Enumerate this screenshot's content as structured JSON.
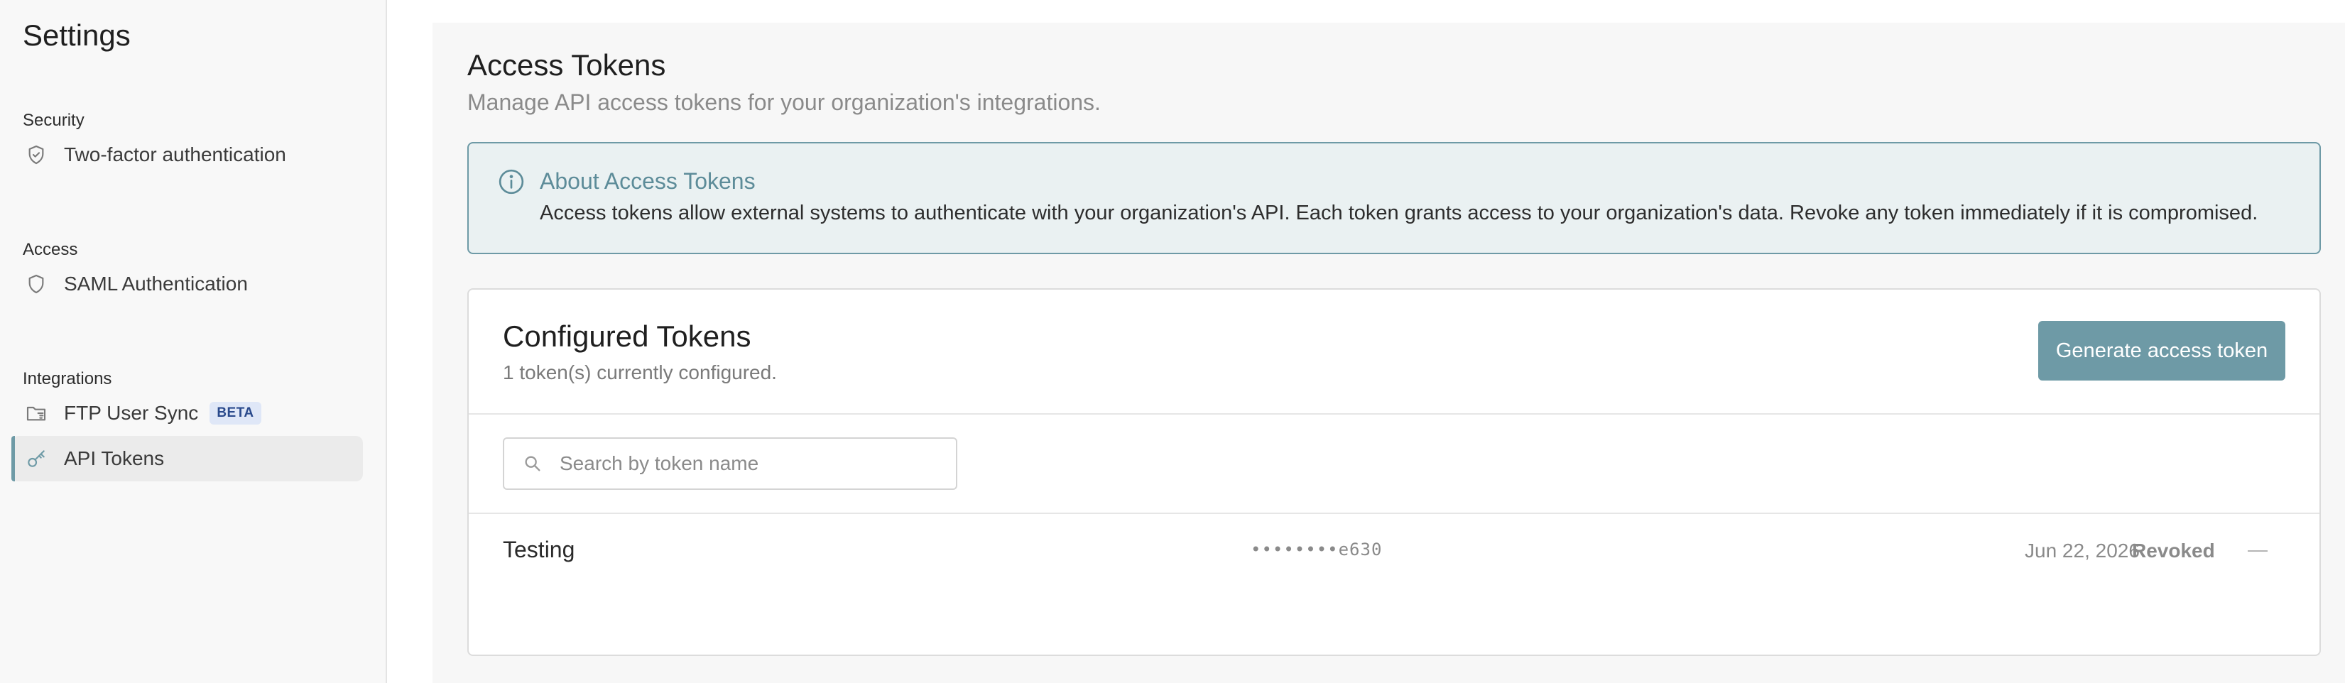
{
  "sidebar": {
    "title": "Settings",
    "sections": [
      {
        "label": "Security",
        "items": [
          {
            "label": "Two-factor authentication",
            "icon": "shield-check-icon"
          }
        ]
      },
      {
        "label": "Access",
        "items": [
          {
            "label": "SAML Authentication",
            "icon": "shield-icon"
          }
        ]
      },
      {
        "label": "Integrations",
        "items": [
          {
            "label": "FTP User Sync",
            "icon": "folder-sync-icon",
            "badge": "BETA"
          },
          {
            "label": "API Tokens",
            "icon": "key-icon",
            "active": true
          }
        ]
      }
    ]
  },
  "page": {
    "title": "Access Tokens",
    "subtitle": "Manage API access tokens for your organization's integrations."
  },
  "info": {
    "title": "About Access Tokens",
    "text": "Access tokens allow external systems to authenticate with your organization's API. Each token grants access to your organization's data. Revoke any token immediately if it is compromised."
  },
  "card": {
    "title": "Configured Tokens",
    "subtitle": "1 token(s) currently configured.",
    "generate_label": "Generate access token",
    "search_placeholder": "Search by token name",
    "tokens": [
      {
        "name": "Testing",
        "masked": "••••••••e630",
        "date": "Jun 22, 2026",
        "status": "Revoked",
        "action": "—"
      }
    ]
  },
  "colors": {
    "accent": "#6e9aa6",
    "info_bg": "#eaf1f2",
    "badge_bg": "#dfe7f7",
    "badge_text": "#2a4a8c"
  }
}
